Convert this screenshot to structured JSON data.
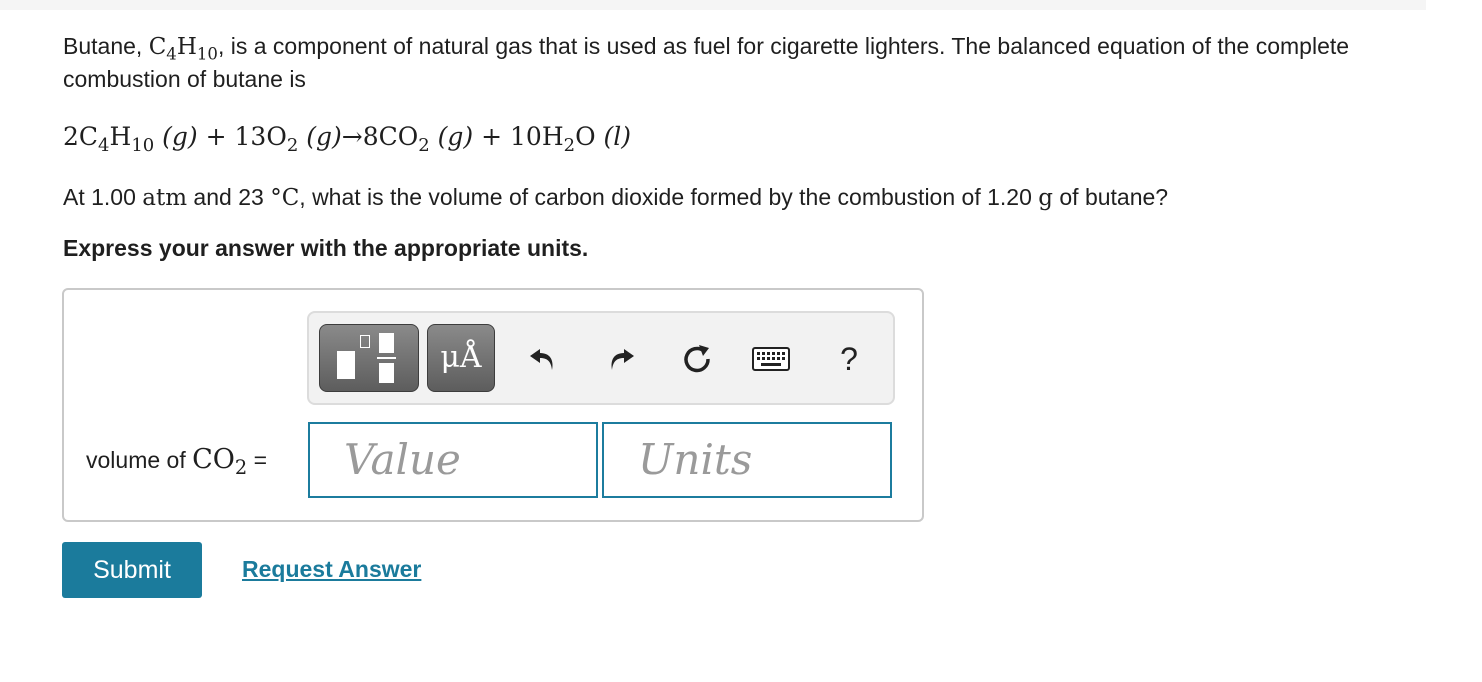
{
  "problem": {
    "intro_prefix": "Butane, ",
    "butane_c": "C",
    "butane_c_sub": "4",
    "butane_h": "H",
    "butane_h_sub": "10",
    "intro_suffix": ", is a component of natural gas that is used as fuel for cigarette lighters. The balanced equation of the complete combustion of butane is",
    "equation": {
      "coef1": "2C",
      "c_sub": "4",
      "h": "H",
      "h_sub": "10",
      "state1": "(g)",
      "plus1": " + 13O",
      "o_sub": "2",
      "state2": "(g)",
      "arrow": "→8CO",
      "co2_sub": "2",
      "state3": "(g)",
      "plus2": " + 10H",
      "h2o_sub": "2",
      "o": "O",
      "state4": "(l)"
    },
    "question_part1": "At 1.00 ",
    "question_atm": "atm",
    "question_part2": " and 23 ",
    "question_deg": "°C",
    "question_part3": ", what is the volume of carbon dioxide formed by the combustion of 1.20 ",
    "question_g": "g",
    "question_part4": " of butane?",
    "express": "Express your answer with the appropriate units."
  },
  "toolbar": {
    "units_label": "μÅ",
    "help_label": "?",
    "icons": [
      "templates-icon",
      "units-icon",
      "undo-icon",
      "redo-icon",
      "reset-icon",
      "keyboard-icon",
      "help-icon"
    ]
  },
  "answer": {
    "label_prefix": "volume of ",
    "label_chem": "CO",
    "label_chem_sub": "2",
    "label_suffix": " =",
    "value_placeholder": "Value",
    "units_placeholder": "Units"
  },
  "actions": {
    "submit_label": "Submit",
    "request_label": "Request Answer"
  },
  "colors": {
    "accent": "#1b7b9c",
    "field_border": "#1c7c9e",
    "toolbar_button": "#6e6e6e"
  }
}
